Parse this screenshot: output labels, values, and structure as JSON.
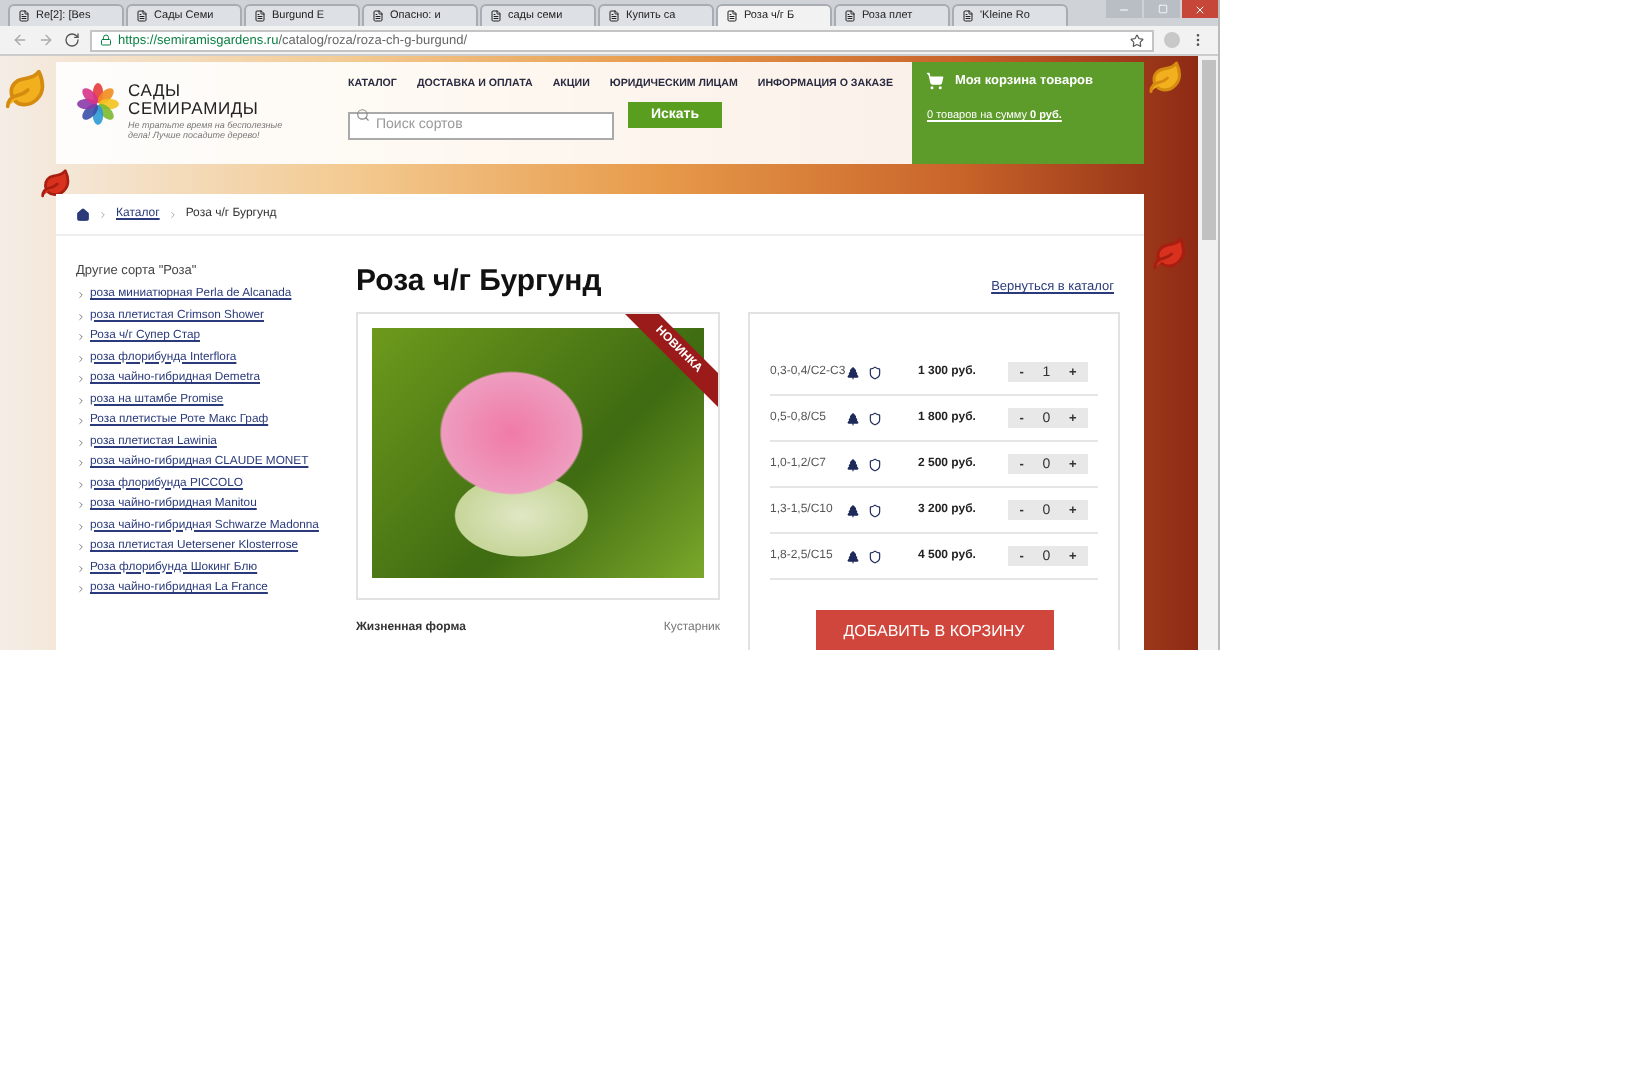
{
  "browser": {
    "tabs": [
      {
        "title": "Re[2]: [Bes",
        "selected": false
      },
      {
        "title": "Сады Семи",
        "selected": false
      },
      {
        "title": "Burgund E",
        "selected": false
      },
      {
        "title": "Опасно: и",
        "selected": false
      },
      {
        "title": "сады семи",
        "selected": false
      },
      {
        "title": "Купить са",
        "selected": false
      },
      {
        "title": "Роза ч/г Б",
        "selected": true
      },
      {
        "title": "Роза плет",
        "selected": false
      },
      {
        "title": "'Kleine Ro",
        "selected": false
      }
    ],
    "url_host": "https://semiramisgardens.ru",
    "url_path": "/catalog/roza/roza-ch-g-burgund/"
  },
  "header": {
    "logo_lines": [
      "САДЫ",
      "СЕМИРАМИДЫ"
    ],
    "tagline": "Не тратьте время на бесполезные дела! Лучше посадите дерево!",
    "nav": [
      "КАТАЛОГ",
      "ДОСТАВКА И ОПЛАТА",
      "АКЦИИ",
      "ЮРИДИЧЕСКИМ ЛИЦАМ",
      "ИНФОРМАЦИЯ О ЗАКАЗЕ"
    ],
    "search": {
      "placeholder": "Поиск сортов",
      "button": "Искать"
    },
    "cart": {
      "title": "Моя корзина товаров",
      "summary": "0 товаров на сумму **0 руб.**"
    }
  },
  "breadcrumb": [
    "Каталог",
    "Роза ч/г Бургунд"
  ],
  "sidebar": {
    "title": "Другие сорта \"Роза\"",
    "items": [
      "роза миниатюрная Perla de Alcanada",
      "роза плетистая Crimson Shower",
      "Роза ч/г Супер Стар",
      "роза флорибунда Interflora",
      "роза чайно-гибридная Demetra",
      "роза на штамбе Promise",
      "Роза плетистые Роте Макс Граф",
      "роза плетистая Lawinia",
      "роза чайно-гибридная CLAUDE MONET",
      "роза флорибунда PICCOLO",
      "роза чайно-гибридная Manitou",
      "роза чайно-гибридная Schwarze Madonna",
      "роза плетистая Uetersener Klosterrose",
      "Роза флорибунда Шокинг Блю",
      "роза чайно-гибридная La France"
    ]
  },
  "product": {
    "title": "Роза ч/г Бургунд",
    "back_link": "Вернуться в каталог",
    "badge": "НОВИНКА",
    "attributes": [
      {
        "label": "Жизненная форма",
        "value": "Кустарник"
      }
    ],
    "offers": [
      {
        "size": "0,3-0,4/C2-C3",
        "price": "1 300 руб.",
        "minus": "-",
        "qty": "1",
        "plus": "+"
      },
      {
        "size": "0,5-0,8/C5",
        "price": "1 800 руб.",
        "minus": "-",
        "qty": "0",
        "plus": "+"
      },
      {
        "size": "1,0-1,2/C7",
        "price": "2 500 руб.",
        "minus": "-",
        "qty": "0",
        "plus": "+"
      },
      {
        "size": "1,3-1,5/C10",
        "price": "3 200 руб.",
        "minus": "-",
        "qty": "0",
        "plus": "+"
      },
      {
        "size": "1,8-2,5/C15",
        "price": "4 500 руб.",
        "minus": "-",
        "qty": "0",
        "plus": "+"
      }
    ],
    "add_button": "ДОБАВИТЬ В КОРЗИНУ"
  }
}
